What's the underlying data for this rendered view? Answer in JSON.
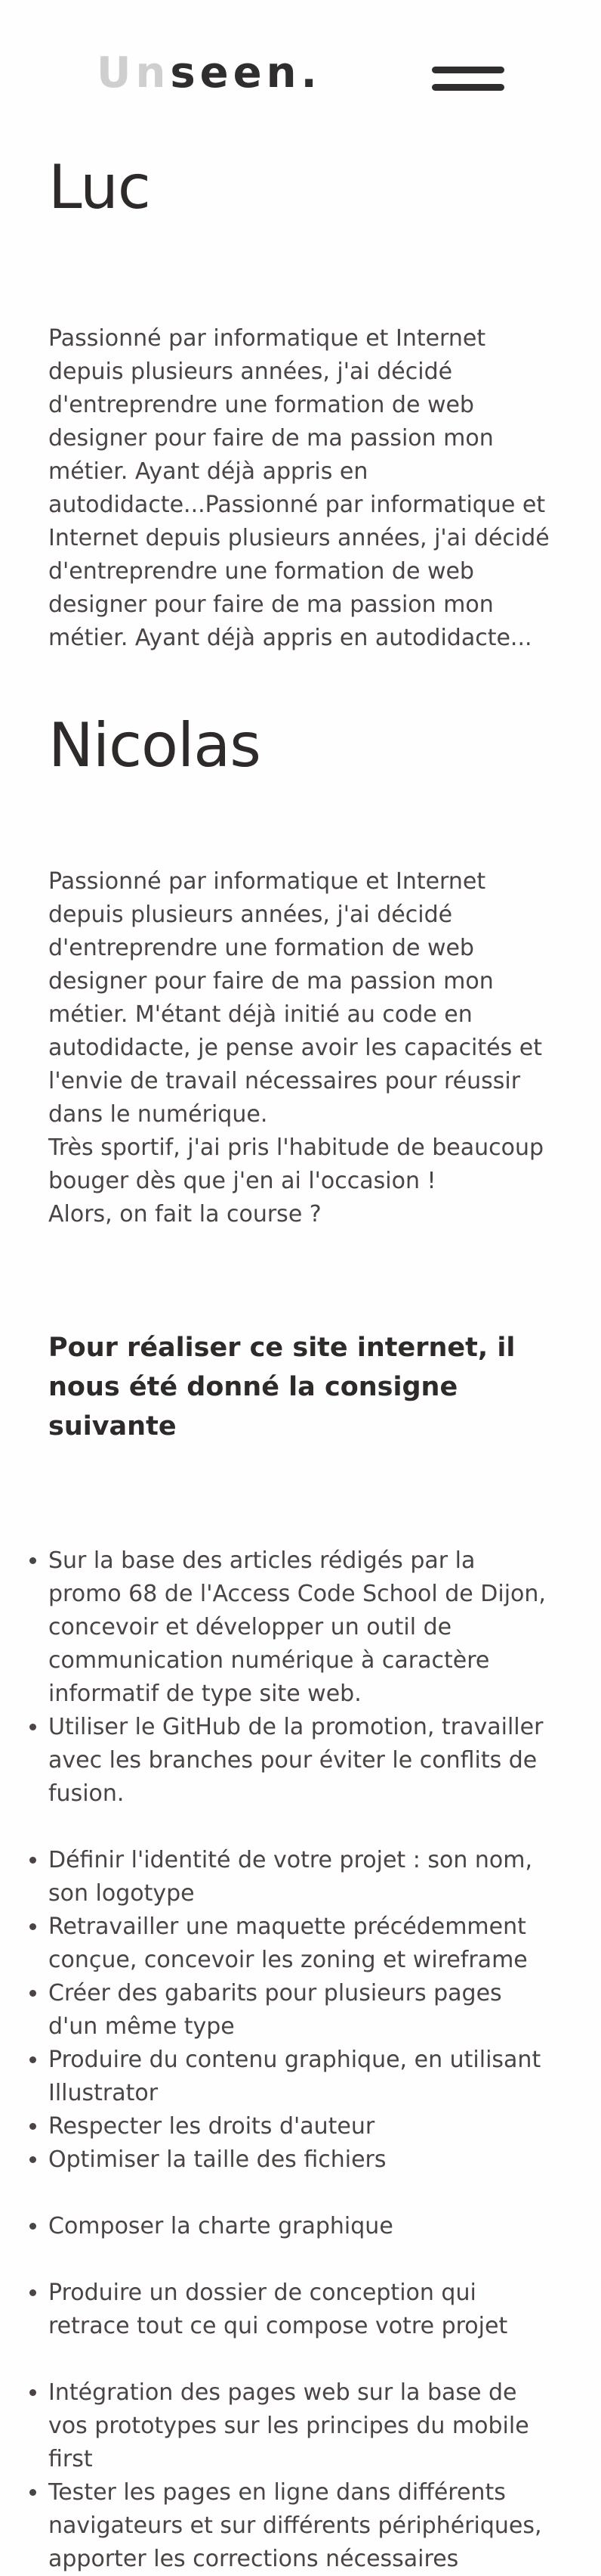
{
  "header": {
    "logo_light": "Un",
    "logo_dark": "seen."
  },
  "members": [
    {
      "name": "Luc",
      "bio": "Passionné par informatique et Internet depuis plusieurs années, j'ai décidé d'entreprendre une formation de web designer pour faire de ma passion mon métier. Ayant déjà appris en autodidacte...Passionné par informatique et Internet depuis plusieurs années, j'ai décidé d'entreprendre une formation de web designer pour faire de ma passion mon métier. Ayant déjà appris en autodidacte..."
    },
    {
      "name": "Nicolas",
      "bio": "Passionné par informatique et Internet depuis plusieurs années, j'ai décidé d'entreprendre une formation de web designer pour faire de ma passion mon métier. M'étant déjà initié au code en autodidacte, je pense avoir les capacités et l'envie de travail nécessaires pour réussir dans le numérique.",
      "bio_line2": "Très sportif, j'ai pris l'habitude de beaucoup bouger dès que j'en ai l'occasion !",
      "bio_line3": "Alors, on fait la course ?"
    }
  ],
  "consigne": {
    "heading": "Pour réaliser ce site internet, il nous été donné la consigne suivante"
  },
  "tasks": {
    "group1": [
      "Sur la base des articles rédigés par la promo 68 de l'Access Code School de Dijon, concevoir et développer un outil de communication numérique à caractère informatif de type site web.",
      "Utiliser le GitHub de la promotion, travailler avec les branches pour éviter le conflits de fusion."
    ],
    "group2": [
      "Définir l'identité de votre projet : son nom, son logotype",
      "Retravailler une maquette précédemment conçue, concevoir les zoning et wireframe",
      "Créer des gabarits pour plusieurs pages d'un même type",
      "Produire du contenu graphique, en utilisant Illustrator",
      "Respecter les droits d'auteur",
      "Optimiser la taille des fichiers"
    ],
    "group3": [
      "Composer la charte graphique"
    ],
    "group4": [
      "Produire un dossier de conception qui retrace tout ce qui compose votre projet"
    ],
    "group5": [
      "Intégration des pages web sur la base de vos prototypes sur les principes du mobile first",
      "Tester les pages en ligne dans différents navigateurs et sur différents périphériques, apporter les corrections nécessaires"
    ]
  }
}
